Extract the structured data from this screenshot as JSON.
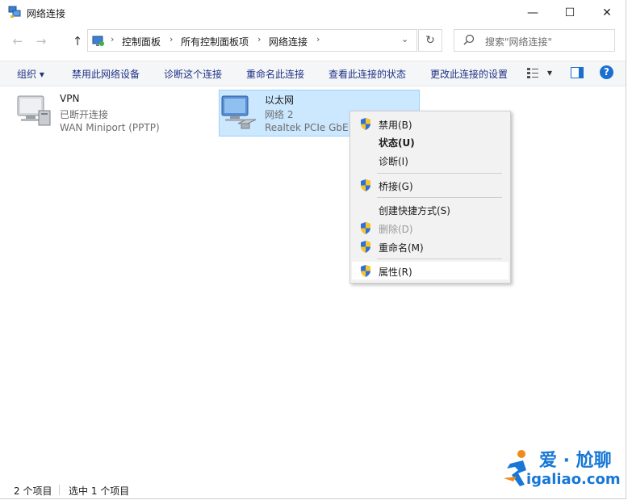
{
  "window": {
    "title": "网络连接",
    "minimize_glyph": "—",
    "maximize_glyph": "☐",
    "close_glyph": "✕"
  },
  "nav": {
    "back_glyph": "←",
    "forward_glyph": "→",
    "up_glyph": "↑"
  },
  "address": {
    "crumbs": [
      "控制面板",
      "所有控制面板项",
      "网络连接"
    ],
    "separator": "›",
    "dropdown_glyph": "⌄",
    "refresh_glyph": "↻"
  },
  "search": {
    "placeholder": "搜索\"网络连接\""
  },
  "toolbar": {
    "organize": "组织 ▾",
    "disable_device": "禁用此网络设备",
    "diagnose": "诊断这个连接",
    "rename": "重命名此连接",
    "view_status": "查看此连接的状态",
    "change_settings": "更改此连接的设置",
    "view_options_glyph": "▾",
    "help_glyph": "?"
  },
  "connections": [
    {
      "name": "VPN",
      "status": "已断开连接",
      "device": "WAN Miniport (PPTP)",
      "selected": false
    },
    {
      "name": "以太网",
      "status": "网络 2",
      "device": "Realtek PCIe GbE",
      "selected": true
    }
  ],
  "context_menu": {
    "items": [
      {
        "label": "禁用(B)",
        "shield": true,
        "bold": false,
        "disabled": false
      },
      {
        "label": "状态(U)",
        "shield": false,
        "bold": true,
        "disabled": false
      },
      {
        "label": "诊断(I)",
        "shield": false,
        "bold": false,
        "disabled": false
      },
      {
        "label": "桥接(G)",
        "shield": true,
        "bold": false,
        "disabled": false
      },
      {
        "label": "创建快捷方式(S)",
        "shield": false,
        "bold": false,
        "disabled": false
      },
      {
        "label": "删除(D)",
        "shield": true,
        "bold": false,
        "disabled": true
      },
      {
        "label": "重命名(M)",
        "shield": true,
        "bold": false,
        "disabled": false
      },
      {
        "label": "属性(R)",
        "shield": true,
        "bold": false,
        "disabled": false,
        "highlighted": true
      }
    ]
  },
  "status": {
    "item_count": "2 个项目",
    "selected_count": "选中 1 个项目"
  },
  "watermark": {
    "cn": "爱 · 尬聊",
    "en": "igaliao.com"
  },
  "colors": {
    "selection_bg": "#cce8ff",
    "command_text": "#1e3287",
    "watermark": "#1677d6"
  }
}
